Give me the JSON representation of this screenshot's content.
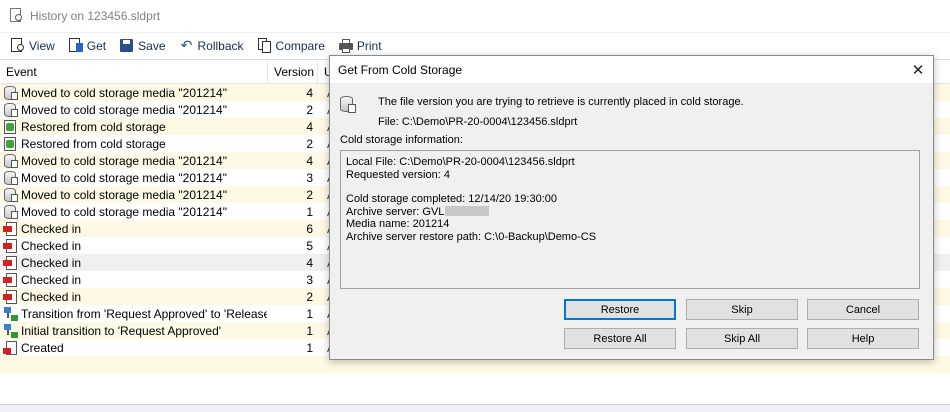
{
  "window": {
    "title": "History on 123456.sldprt"
  },
  "toolbar": {
    "view": "View",
    "get": "Get",
    "save": "Save",
    "rollback": "Rollback",
    "compare": "Compare",
    "print": "Print"
  },
  "list": {
    "columns": {
      "event": "Event",
      "version": "Version",
      "extra": "U"
    },
    "rows": [
      {
        "icon": "cold-storage-icon",
        "event": "Moved to cold storage media \"201214\"",
        "version": "4",
        "extra": "A"
      },
      {
        "icon": "cold-storage-icon",
        "event": "Moved to cold storage media \"201214\"",
        "version": "2",
        "extra": "A"
      },
      {
        "icon": "restored-icon",
        "event": "Restored from cold storage",
        "version": "4",
        "extra": "A"
      },
      {
        "icon": "restored-icon",
        "event": "Restored from cold storage",
        "version": "2",
        "extra": "A"
      },
      {
        "icon": "cold-storage-icon",
        "event": "Moved to cold storage media \"201214\"",
        "version": "4",
        "extra": "A"
      },
      {
        "icon": "cold-storage-icon",
        "event": "Moved to cold storage media \"201214\"",
        "version": "3",
        "extra": "A"
      },
      {
        "icon": "cold-storage-icon",
        "event": "Moved to cold storage media \"201214\"",
        "version": "2",
        "extra": "A"
      },
      {
        "icon": "cold-storage-icon",
        "event": "Moved to cold storage media \"201214\"",
        "version": "1",
        "extra": "A"
      },
      {
        "icon": "check-in-icon",
        "event": "Checked in",
        "version": "6",
        "extra": "A"
      },
      {
        "icon": "check-in-icon",
        "event": "Checked in",
        "version": "5",
        "extra": "A"
      },
      {
        "icon": "check-in-icon",
        "event": "Checked in",
        "version": "4",
        "extra": "A"
      },
      {
        "icon": "check-in-icon",
        "event": "Checked in",
        "version": "3",
        "extra": "A"
      },
      {
        "icon": "check-in-icon",
        "event": "Checked in",
        "version": "2",
        "extra": "A"
      },
      {
        "icon": "transition-icon",
        "event": "Transition from 'Request Approved' to 'Released'",
        "version": "1",
        "extra": "A"
      },
      {
        "icon": "transition-icon",
        "event": "Initial transition to 'Request Approved'",
        "version": "1",
        "extra": "A"
      },
      {
        "icon": "created-icon",
        "event": "Created",
        "version": "1",
        "extra": "A"
      }
    ]
  },
  "dialog": {
    "title": "Get From Cold Storage",
    "message": "The file version you are trying to retrieve is currently placed in cold storage.",
    "file_line": "File: C:\\Demo\\PR-20-0004\\123456.sldprt",
    "section_label": "Cold storage information:",
    "info": {
      "local_file": "Local File: C:\\Demo\\PR-20-0004\\123456.sldprt",
      "requested_version": "Requested version: 4",
      "completed": "Cold storage completed: 12/14/20 19:30:00",
      "archive_server": "Archive server: GVL",
      "media_name": "Media name: 201214",
      "restore_path": "Archive server restore path: C:\\0-Backup\\Demo-CS"
    },
    "buttons": {
      "restore": "Restore",
      "skip": "Skip",
      "cancel": "Cancel",
      "restore_all": "Restore All",
      "skip_all": "Skip All",
      "help": "Help"
    }
  }
}
